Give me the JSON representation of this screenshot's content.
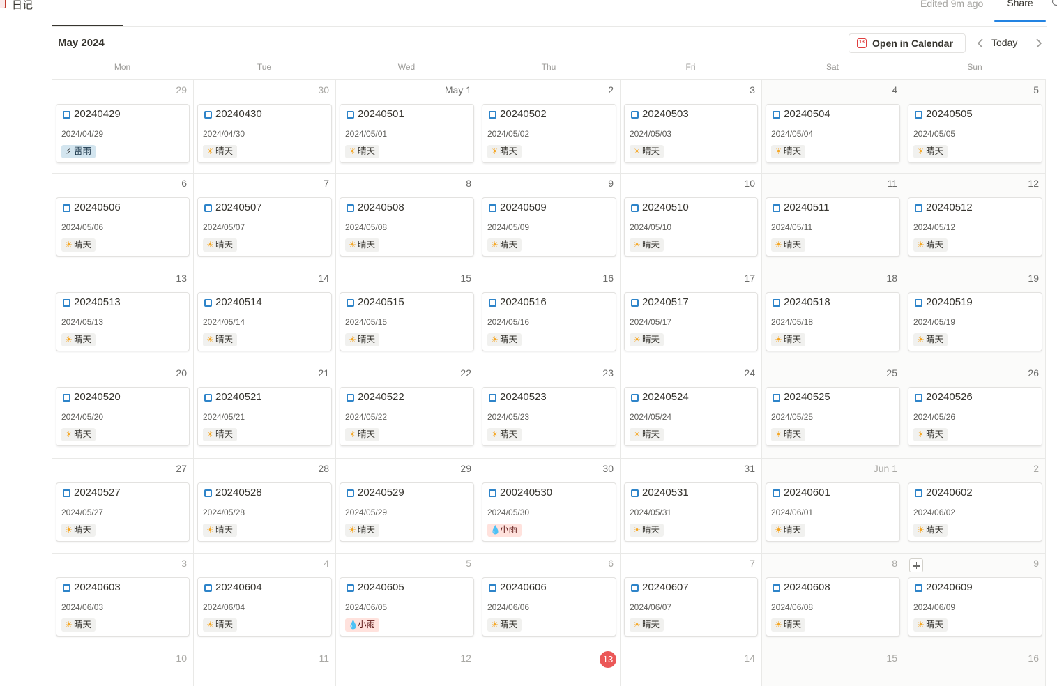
{
  "page": {
    "title": "日记",
    "edited": "Edited 9m ago",
    "share_label": "Share"
  },
  "calendar": {
    "month_title": "May 2024",
    "open_in_calendar_label": "Open in Calendar",
    "open_in_calendar_icon_text": "13",
    "today_label": "Today",
    "weekdays": [
      "Mon",
      "Tue",
      "Wed",
      "Thu",
      "Fri",
      "Sat",
      "Sun"
    ],
    "weeks": [
      [
        {
          "label": "29",
          "dim": true,
          "entry": {
            "title": "20240429",
            "date": "2024/04/29",
            "weather": "雷雨",
            "kind": "storm"
          }
        },
        {
          "label": "30",
          "dim": true,
          "entry": {
            "title": "20240430",
            "date": "2024/04/30",
            "weather": "晴天",
            "kind": "sunny"
          }
        },
        {
          "label": "May 1",
          "entry": {
            "title": "20240501",
            "date": "2024/05/01",
            "weather": "晴天",
            "kind": "sunny"
          }
        },
        {
          "label": "2",
          "entry": {
            "title": "20240502",
            "date": "2024/05/02",
            "weather": "晴天",
            "kind": "sunny"
          }
        },
        {
          "label": "3",
          "entry": {
            "title": "20240503",
            "date": "2024/05/03",
            "weather": "晴天",
            "kind": "sunny"
          }
        },
        {
          "label": "4",
          "entry": {
            "title": "20240504",
            "date": "2024/05/04",
            "weather": "晴天",
            "kind": "sunny"
          }
        },
        {
          "label": "5",
          "entry": {
            "title": "20240505",
            "date": "2024/05/05",
            "weather": "晴天",
            "kind": "sunny"
          }
        }
      ],
      [
        {
          "label": "6",
          "entry": {
            "title": "20240506",
            "date": "2024/05/06",
            "weather": "晴天",
            "kind": "sunny"
          }
        },
        {
          "label": "7",
          "entry": {
            "title": "20240507",
            "date": "2024/05/07",
            "weather": "晴天",
            "kind": "sunny"
          }
        },
        {
          "label": "8",
          "entry": {
            "title": "20240508",
            "date": "2024/05/08",
            "weather": "晴天",
            "kind": "sunny"
          }
        },
        {
          "label": "9",
          "entry": {
            "title": "20240509",
            "date": "2024/05/09",
            "weather": "晴天",
            "kind": "sunny"
          }
        },
        {
          "label": "10",
          "entry": {
            "title": "20240510",
            "date": "2024/05/10",
            "weather": "晴天",
            "kind": "sunny"
          }
        },
        {
          "label": "11",
          "entry": {
            "title": "20240511",
            "date": "2024/05/11",
            "weather": "晴天",
            "kind": "sunny"
          }
        },
        {
          "label": "12",
          "entry": {
            "title": "20240512",
            "date": "2024/05/12",
            "weather": "晴天",
            "kind": "sunny"
          }
        }
      ],
      [
        {
          "label": "13",
          "entry": {
            "title": "20240513",
            "date": "2024/05/13",
            "weather": "晴天",
            "kind": "sunny"
          }
        },
        {
          "label": "14",
          "entry": {
            "title": "20240514",
            "date": "2024/05/14",
            "weather": "晴天",
            "kind": "sunny"
          }
        },
        {
          "label": "15",
          "entry": {
            "title": "20240515",
            "date": "2024/05/15",
            "weather": "晴天",
            "kind": "sunny"
          }
        },
        {
          "label": "16",
          "entry": {
            "title": "20240516",
            "date": "2024/05/16",
            "weather": "晴天",
            "kind": "sunny"
          }
        },
        {
          "label": "17",
          "entry": {
            "title": "20240517",
            "date": "2024/05/17",
            "weather": "晴天",
            "kind": "sunny"
          }
        },
        {
          "label": "18",
          "entry": {
            "title": "20240518",
            "date": "2024/05/18",
            "weather": "晴天",
            "kind": "sunny"
          }
        },
        {
          "label": "19",
          "entry": {
            "title": "20240519",
            "date": "2024/05/19",
            "weather": "晴天",
            "kind": "sunny"
          }
        }
      ],
      [
        {
          "label": "20",
          "entry": {
            "title": "20240520",
            "date": "2024/05/20",
            "weather": "晴天",
            "kind": "sunny"
          }
        },
        {
          "label": "21",
          "entry": {
            "title": "20240521",
            "date": "2024/05/21",
            "weather": "晴天",
            "kind": "sunny"
          }
        },
        {
          "label": "22",
          "entry": {
            "title": "20240522",
            "date": "2024/05/22",
            "weather": "晴天",
            "kind": "sunny"
          }
        },
        {
          "label": "23",
          "entry": {
            "title": "20240523",
            "date": "2024/05/23",
            "weather": "晴天",
            "kind": "sunny"
          }
        },
        {
          "label": "24",
          "entry": {
            "title": "20240524",
            "date": "2024/05/24",
            "weather": "晴天",
            "kind": "sunny"
          }
        },
        {
          "label": "25",
          "entry": {
            "title": "20240525",
            "date": "2024/05/25",
            "weather": "晴天",
            "kind": "sunny"
          }
        },
        {
          "label": "26",
          "entry": {
            "title": "20240526",
            "date": "2024/05/26",
            "weather": "晴天",
            "kind": "sunny"
          }
        }
      ],
      [
        {
          "label": "27",
          "entry": {
            "title": "20240527",
            "date": "2024/05/27",
            "weather": "晴天",
            "kind": "sunny"
          }
        },
        {
          "label": "28",
          "entry": {
            "title": "20240528",
            "date": "2024/05/28",
            "weather": "晴天",
            "kind": "sunny"
          }
        },
        {
          "label": "29",
          "entry": {
            "title": "20240529",
            "date": "2024/05/29",
            "weather": "晴天",
            "kind": "sunny"
          }
        },
        {
          "label": "30",
          "entry": {
            "title": "200240530",
            "date": "2024/05/30",
            "weather": "小雨",
            "kind": "rain"
          }
        },
        {
          "label": "31",
          "entry": {
            "title": "20240531",
            "date": "2024/05/31",
            "weather": "晴天",
            "kind": "sunny"
          }
        },
        {
          "label": "Jun 1",
          "dim": true,
          "entry": {
            "title": "20240601",
            "date": "2024/06/01",
            "weather": "晴天",
            "kind": "sunny"
          }
        },
        {
          "label": "2",
          "dim": true,
          "entry": {
            "title": "20240602",
            "date": "2024/06/02",
            "weather": "晴天",
            "kind": "sunny"
          }
        }
      ],
      [
        {
          "label": "3",
          "dim": true,
          "entry": {
            "title": "20240603",
            "date": "2024/06/03",
            "weather": "晴天",
            "kind": "sunny"
          }
        },
        {
          "label": "4",
          "dim": true,
          "entry": {
            "title": "20240604",
            "date": "2024/06/04",
            "weather": "晴天",
            "kind": "sunny"
          }
        },
        {
          "label": "5",
          "dim": true,
          "entry": {
            "title": "20240605",
            "date": "2024/06/05",
            "weather": "小雨",
            "kind": "rain"
          }
        },
        {
          "label": "6",
          "dim": true,
          "entry": {
            "title": "20240606",
            "date": "2024/06/06",
            "weather": "晴天",
            "kind": "sunny"
          }
        },
        {
          "label": "7",
          "dim": true,
          "entry": {
            "title": "20240607",
            "date": "2024/06/07",
            "weather": "晴天",
            "kind": "sunny"
          }
        },
        {
          "label": "8",
          "dim": true,
          "entry": {
            "title": "20240608",
            "date": "2024/06/08",
            "weather": "晴天",
            "kind": "sunny"
          }
        },
        {
          "label": "9",
          "dim": true,
          "add_button": true,
          "entry": {
            "title": "20240609",
            "date": "2024/06/09",
            "weather": "晴天",
            "kind": "sunny"
          }
        }
      ],
      [
        {
          "label": "10",
          "dim": true
        },
        {
          "label": "11",
          "dim": true
        },
        {
          "label": "12",
          "dim": true
        },
        {
          "label": "13",
          "today": true
        },
        {
          "label": "14",
          "dim": true
        },
        {
          "label": "15",
          "dim": true
        },
        {
          "label": "16",
          "dim": true
        }
      ]
    ]
  },
  "icons": {
    "page": "notebook-icon",
    "entry": "page-icon",
    "sunny": "sun-icon",
    "rain": "rain-icon",
    "storm": "lightning-icon",
    "sunny_glyph": "☀",
    "rain_glyph": "💧",
    "storm_glyph": "⚡"
  },
  "colors": {
    "today": "#eb5757",
    "accent": "#2383e2",
    "entry_icon": "#2e84c9"
  }
}
